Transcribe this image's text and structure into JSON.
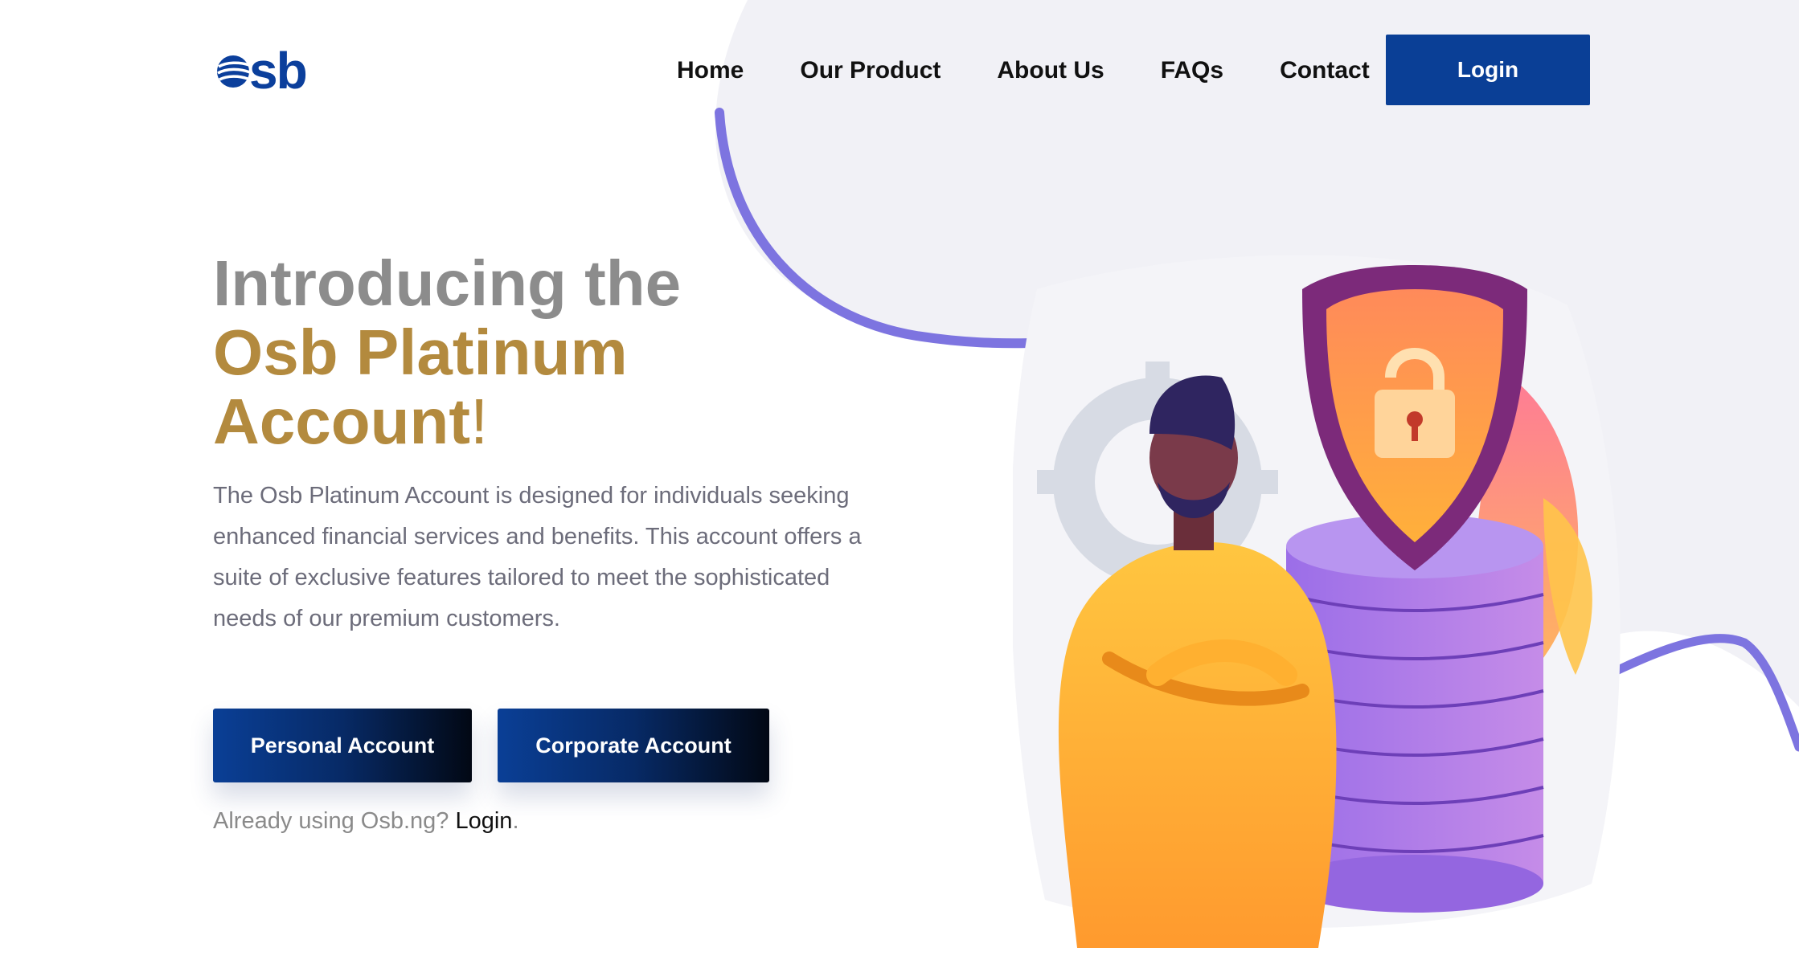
{
  "brand": {
    "logo_text": "sb",
    "logo_icon": "globe-icon",
    "primary_color": "#0a3f96",
    "gold_color": "#b38a3e"
  },
  "nav": {
    "items": [
      {
        "label": "Home"
      },
      {
        "label": "Our Product"
      },
      {
        "label": "About Us"
      },
      {
        "label": "FAQs"
      },
      {
        "label": "Contact"
      }
    ],
    "login_label": "Login"
  },
  "hero": {
    "title_line1": "Introducing the",
    "title_line2": "Osb Platinum",
    "title_line3": "Account",
    "title_punct": "!",
    "description": "The Osb Platinum Account is designed for individuals seeking enhanced financial services and benefits. This account offers a suite of exclusive features tailored to meet the sophisticated needs of our premium customers.",
    "personal_button": "Personal Account",
    "corporate_button": "Corporate Account",
    "already_text": "Already using Osb.ng?",
    "already_link": "Login",
    "already_suffix": "."
  },
  "illustration": {
    "icons": [
      "person-icon",
      "shield-lock-icon",
      "gear-icon",
      "database-stack-icon",
      "plant-icon"
    ]
  }
}
